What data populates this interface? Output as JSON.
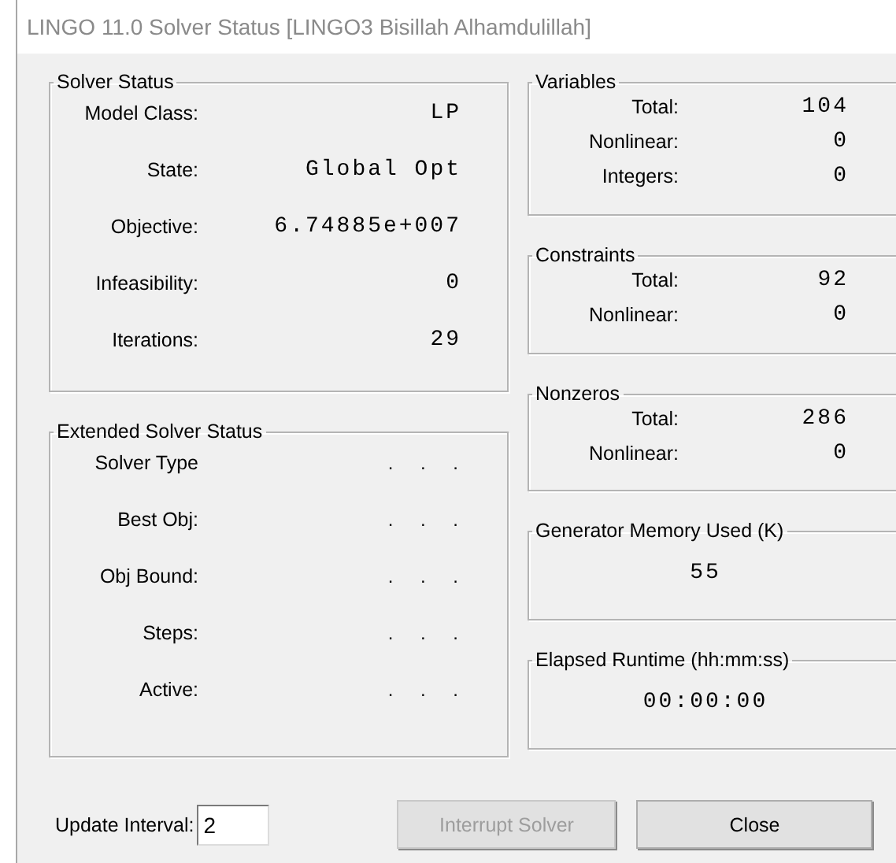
{
  "window": {
    "title": "LINGO 11.0 Solver Status [LINGO3 Bisillah Alhamdulillah]"
  },
  "solver_status": {
    "title": "Solver Status",
    "rows": [
      {
        "label": "Model Class:",
        "value": "LP"
      },
      {
        "label": "State:",
        "value": "Global Opt"
      },
      {
        "label": "Objective:",
        "value": "6.74885e+007"
      },
      {
        "label": "Infeasibility:",
        "value": "0"
      },
      {
        "label": "Iterations:",
        "value": "29"
      }
    ]
  },
  "extended_solver_status": {
    "title": "Extended Solver Status",
    "rows": [
      {
        "label": "Solver Type",
        "value": ". . ."
      },
      {
        "label": "Best Obj:",
        "value": ". . ."
      },
      {
        "label": "Obj Bound:",
        "value": ". . ."
      },
      {
        "label": "Steps:",
        "value": ". . ."
      },
      {
        "label": "Active:",
        "value": ". . ."
      }
    ]
  },
  "counts": [
    {
      "title": "Variables",
      "rows": [
        {
          "label": "Total:",
          "value": "104"
        },
        {
          "label": "Nonlinear:",
          "value": "0"
        },
        {
          "label": "Integers:",
          "value": "0"
        }
      ]
    },
    {
      "title": "Constraints",
      "rows": [
        {
          "label": "Total:",
          "value": "92"
        },
        {
          "label": "Nonlinear:",
          "value": "0"
        }
      ]
    },
    {
      "title": "Nonzeros",
      "rows": [
        {
          "label": "Total:",
          "value": "286"
        },
        {
          "label": "Nonlinear:",
          "value": "0"
        }
      ]
    }
  ],
  "generator_memory": {
    "title": "Generator Memory Used (K)",
    "value": "55"
  },
  "elapsed_runtime": {
    "title": "Elapsed Runtime (hh:mm:ss)",
    "value": "00:00:00"
  },
  "update_interval": {
    "label": "Update Interval:",
    "value": "2"
  },
  "buttons": [
    {
      "label": "Interrupt Solver",
      "disabled": true
    },
    {
      "label": "Close",
      "disabled": false
    }
  ]
}
